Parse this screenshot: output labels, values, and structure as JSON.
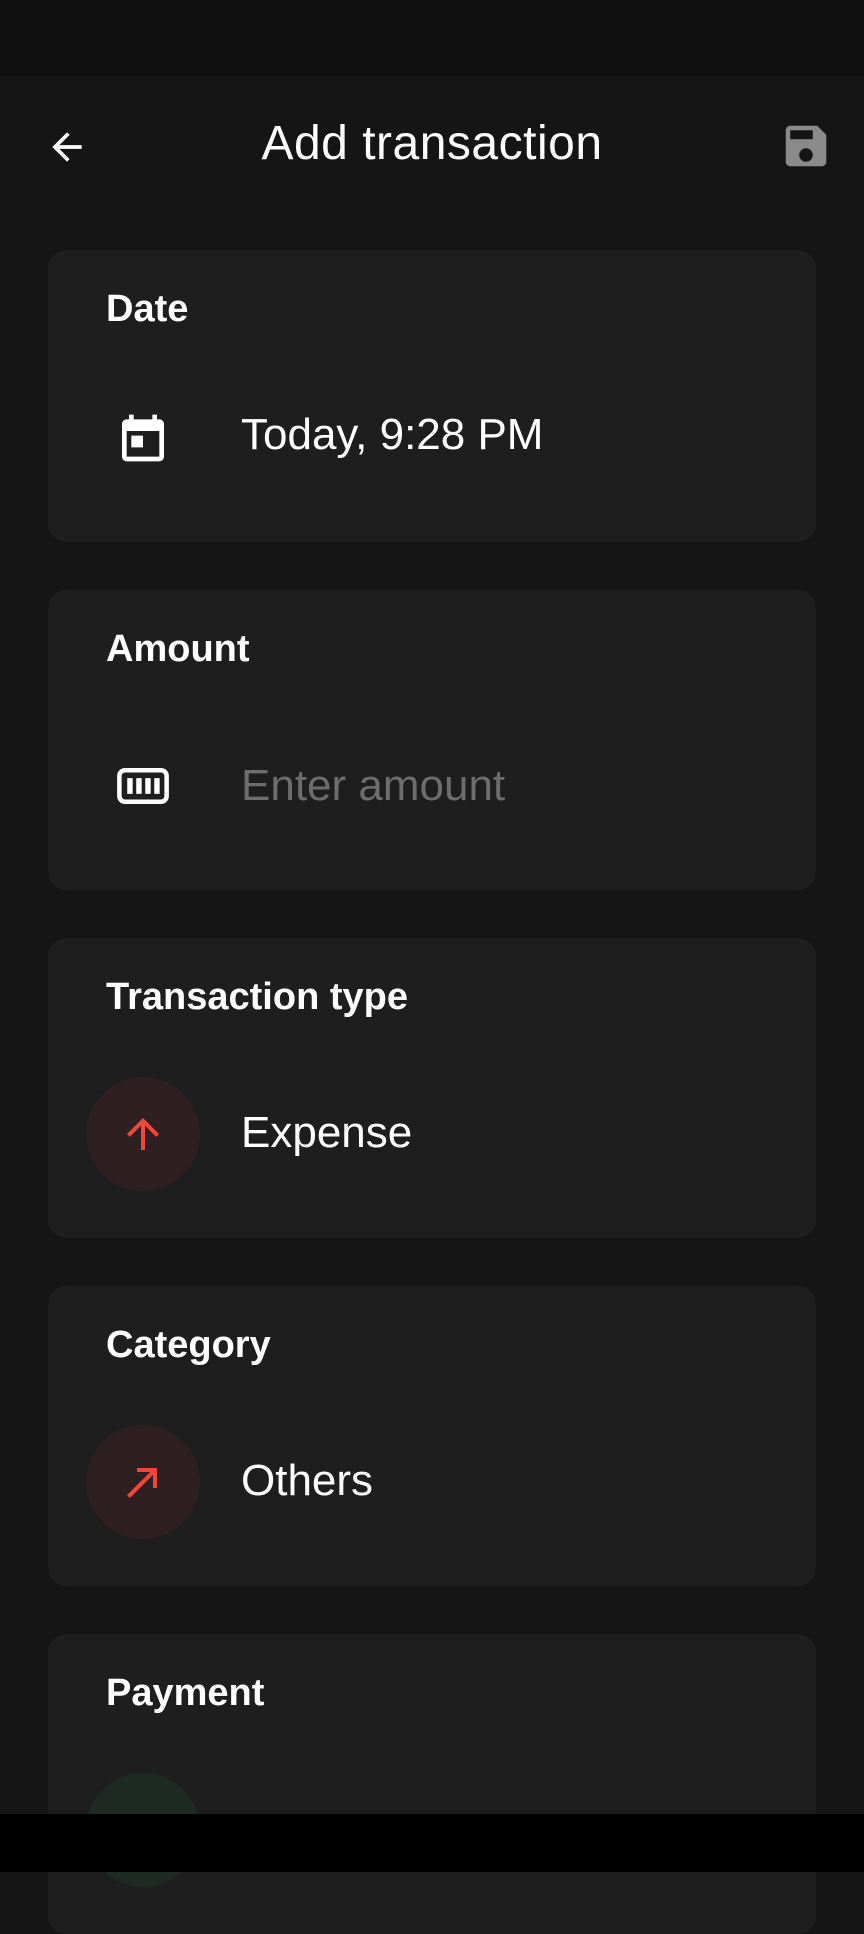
{
  "header": {
    "title": "Add transaction",
    "back_icon": "arrow-left-icon",
    "save_icon": "save-floppy-icon"
  },
  "date": {
    "label": "Date",
    "icon": "calendar-icon",
    "value": "Today, 9:28 PM"
  },
  "amount": {
    "label": "Amount",
    "icon": "cash-icon",
    "value": "",
    "placeholder": "Enter amount"
  },
  "transaction_type": {
    "label": "Transaction type",
    "icon": "arrow-up-icon",
    "value": "Expense"
  },
  "category": {
    "label": "Category",
    "icon": "arrow-up-right-icon",
    "value": "Others"
  },
  "payment": {
    "label": "Payment",
    "icon": "payment-method-icon"
  },
  "colors": {
    "background": "#151515",
    "card": "#1e1e1e",
    "expense_red": "#f2463b",
    "payment_green": "#2fd46b",
    "placeholder": "#6d6d6d",
    "save_icon_gray": "#8a8a8a"
  }
}
